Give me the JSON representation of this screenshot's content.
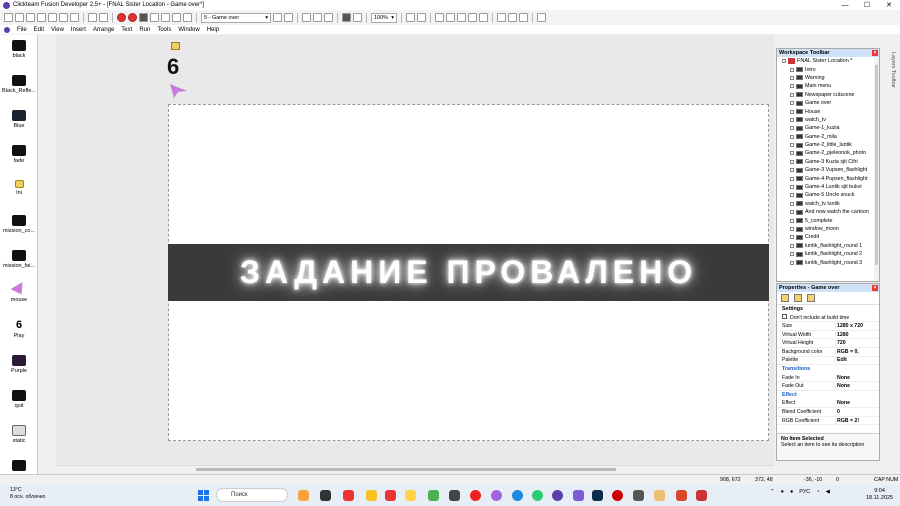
{
  "window": {
    "title": "Clickteam Fusion Developer 2.5+ - [FNAL Sister Location - Game over*]",
    "min": "—",
    "max": "☐",
    "close": "✕"
  },
  "toolbar": {
    "frame_combo": "5 - Game over",
    "zoom": "100%"
  },
  "menu": [
    "File",
    "Edit",
    "View",
    "Insert",
    "Arrange",
    "Text",
    "Run",
    "Tools",
    "Window",
    "Help"
  ],
  "objects": [
    {
      "label": "black"
    },
    {
      "label": "Black_Refle..."
    },
    {
      "label": "Blue"
    },
    {
      "label": "fade"
    },
    {
      "label": "Ini"
    },
    {
      "label": "mission_co..."
    },
    {
      "label": "mission_fai..."
    },
    {
      "label": "mouse"
    },
    {
      "label": "Play"
    },
    {
      "label": "Purple"
    },
    {
      "label": "quit"
    },
    {
      "label": "static"
    }
  ],
  "scene": {
    "counter_value": "6",
    "banner_text": "ЗАДАНИЕ ПРОВАЛЕНО"
  },
  "workspace": {
    "title": "Workspace Toolbar",
    "root": "FNAL Sister Location *",
    "frames": [
      "Intro",
      "Warning",
      "Main menu",
      "Newspaper cutscene",
      "Game over",
      "House",
      "watch_tv",
      "Game-1_kuzia",
      "Game-2_mila",
      "Game-2_little_luntik",
      "Game-2_pjeleonok_photo",
      "Game-3 Kuzia sjit Cifri",
      "Game-3 Vupsen_flashlight",
      "Game-4 Pupsen_flashlight",
      "Game-4 Luntik sjit bukvi",
      "Game-5 Uncle snuck",
      "watch_tv luntik",
      "And now watch the cartoon",
      "5_complete",
      "window_moon",
      "Credit",
      "luntik_flashlight_round 1",
      "luntik_flashlight_round 2",
      "luntik_flashlight_round 3"
    ]
  },
  "properties": {
    "title": "Properties - Game over",
    "settings": "Settings",
    "dont_include": "Don't include at build time",
    "rows1": [
      {
        "k": "Size",
        "v": "1280 x 720"
      },
      {
        "k": "Virtual Width",
        "v": "1280"
      },
      {
        "k": "Virtual Height",
        "v": "720"
      },
      {
        "k": "Background color",
        "v": "RGB = 0,"
      },
      {
        "k": "Palette",
        "v": "Edit"
      }
    ],
    "transitions": "Transitions",
    "rows2": [
      {
        "k": "Fade In",
        "v": "None"
      },
      {
        "k": "Fade Out",
        "v": "None"
      }
    ],
    "effect_section": "Effect",
    "rows3": [
      {
        "k": "Effect",
        "v": "None"
      },
      {
        "k": "Blend Coefficient",
        "v": "0"
      },
      {
        "k": "RGB Coefficient",
        "v": "RGB = 2!"
      }
    ],
    "footer_title": "No Item Selected",
    "footer_text": "Select an item to see its description"
  },
  "side_tab": "Layers Toolbar",
  "status": {
    "coords1": "908, 672",
    "coords2": "372, 48",
    "coords3": "-36, -10",
    "coords4": "0",
    "caps": "CAP NUM"
  },
  "taskbar": {
    "temp": "13°C",
    "weather": "8 осн. облачно",
    "search": "Поиск",
    "lang": "РУС",
    "time": "9:04",
    "date": "18.11.2025"
  }
}
